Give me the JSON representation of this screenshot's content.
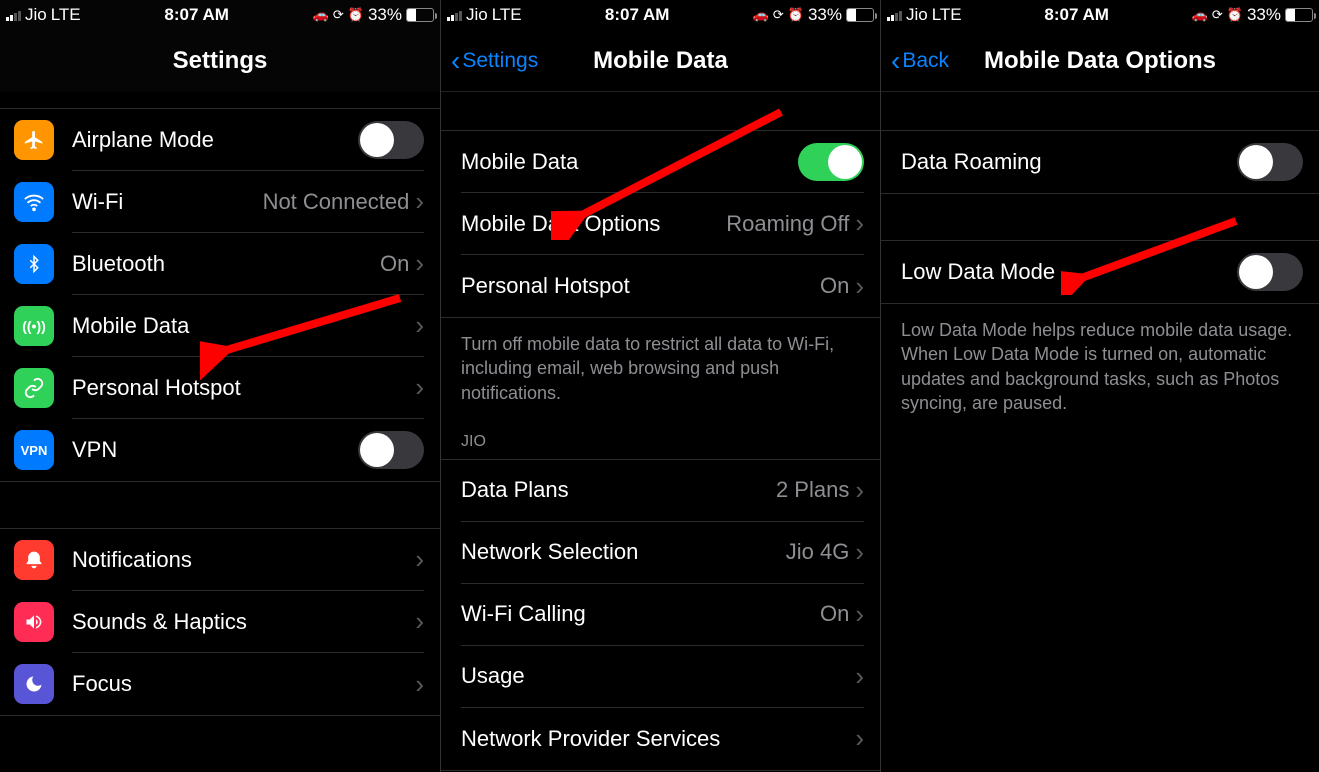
{
  "status": {
    "carrier": "Jio",
    "network": "LTE",
    "time": "8:07 AM",
    "battery_pct": "33%",
    "battery_fill_pct": 33
  },
  "screen1": {
    "title": "Settings",
    "items1": [
      {
        "icon_bg": "#ff9500",
        "icon": "✈",
        "name": "airplane-mode",
        "label": "Airplane Mode",
        "value": "",
        "type": "toggle",
        "toggle": "off"
      },
      {
        "icon_bg": "#007aff",
        "icon": "wifi",
        "name": "wifi",
        "label": "Wi-Fi",
        "value": "Not Connected",
        "type": "link"
      },
      {
        "icon_bg": "#007aff",
        "icon": "bt",
        "name": "bluetooth",
        "label": "Bluetooth",
        "value": "On",
        "type": "link"
      },
      {
        "icon_bg": "#30d158",
        "icon": "((•))",
        "name": "mobile-data",
        "label": "Mobile Data",
        "value": "",
        "type": "link"
      },
      {
        "icon_bg": "#30d158",
        "icon": "link",
        "name": "personal-hotspot",
        "label": "Personal Hotspot",
        "value": "",
        "type": "link"
      },
      {
        "icon_bg": "#007aff",
        "icon_text": "VPN",
        "name": "vpn",
        "label": "VPN",
        "value": "",
        "type": "toggle",
        "toggle": "off"
      }
    ],
    "items2": [
      {
        "icon_bg": "#ff3b30",
        "icon": "bell",
        "name": "notifications",
        "label": "Notifications",
        "value": "",
        "type": "link"
      },
      {
        "icon_bg": "#ff2d55",
        "icon": "sound",
        "name": "sounds-haptics",
        "label": "Sounds & Haptics",
        "value": "",
        "type": "link"
      },
      {
        "icon_bg": "#5856d6",
        "icon": "moon",
        "name": "focus",
        "label": "Focus",
        "value": "",
        "type": "link"
      }
    ]
  },
  "screen2": {
    "back": "Settings",
    "title": "Mobile Data",
    "group1": [
      {
        "name": "mobile-data-toggle",
        "label": "Mobile Data",
        "type": "toggle",
        "toggle": "on"
      },
      {
        "name": "mobile-data-options",
        "label": "Mobile Data Options",
        "value": "Roaming Off",
        "type": "link"
      },
      {
        "name": "personal-hotspot",
        "label": "Personal Hotspot",
        "value": "On",
        "type": "link"
      }
    ],
    "footer1": "Turn off mobile data to restrict all data to Wi-Fi, including email, web browsing and push notifications.",
    "section_header": "JIO",
    "group2": [
      {
        "name": "data-plans",
        "label": "Data Plans",
        "value": "2 Plans",
        "type": "link"
      },
      {
        "name": "network-selection",
        "label": "Network Selection",
        "value": "Jio 4G",
        "type": "link"
      },
      {
        "name": "wifi-calling",
        "label": "Wi-Fi Calling",
        "value": "On",
        "type": "link"
      },
      {
        "name": "usage",
        "label": "Usage",
        "value": "",
        "type": "link"
      },
      {
        "name": "network-provider-services",
        "label": "Network Provider Services",
        "value": "",
        "type": "link"
      }
    ]
  },
  "screen3": {
    "back": "Back",
    "title": "Mobile Data Options",
    "group1": [
      {
        "name": "data-roaming",
        "label": "Data Roaming",
        "type": "toggle",
        "toggle": "off"
      }
    ],
    "group2": [
      {
        "name": "low-data-mode",
        "label": "Low Data Mode",
        "type": "toggle",
        "toggle": "off"
      }
    ],
    "footer2": "Low Data Mode helps reduce mobile data usage. When Low Data Mode is turned on, automatic updates and background tasks, such as Photos syncing, are paused."
  }
}
